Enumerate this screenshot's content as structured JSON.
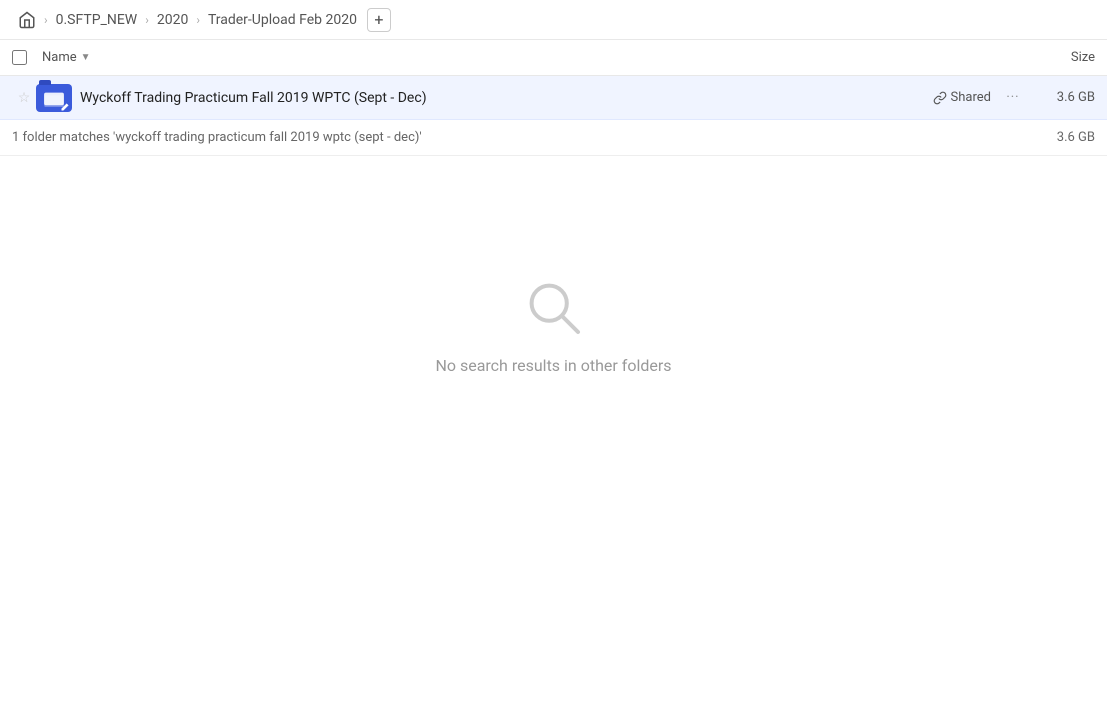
{
  "breadcrumb": {
    "home_icon": "🏠",
    "items": [
      {
        "label": "0.SFTP_NEW"
      },
      {
        "label": "2020"
      },
      {
        "label": "Trader-Upload Feb 2020"
      }
    ],
    "add_icon": "+"
  },
  "columns": {
    "name_label": "Name",
    "size_label": "Size"
  },
  "file_row": {
    "star_icon": "☆",
    "name": "Wyckoff Trading Practicum Fall 2019 WPTC (Sept - Dec)",
    "shared_icon": "🔗",
    "shared_label": "Shared",
    "more_icon": "···",
    "size": "3.6 GB"
  },
  "status": {
    "text": "1 folder matches 'wyckoff trading practicum fall 2019 wptc (sept - dec)'",
    "size": "3.6 GB"
  },
  "empty_state": {
    "text": "No search results in other folders"
  }
}
